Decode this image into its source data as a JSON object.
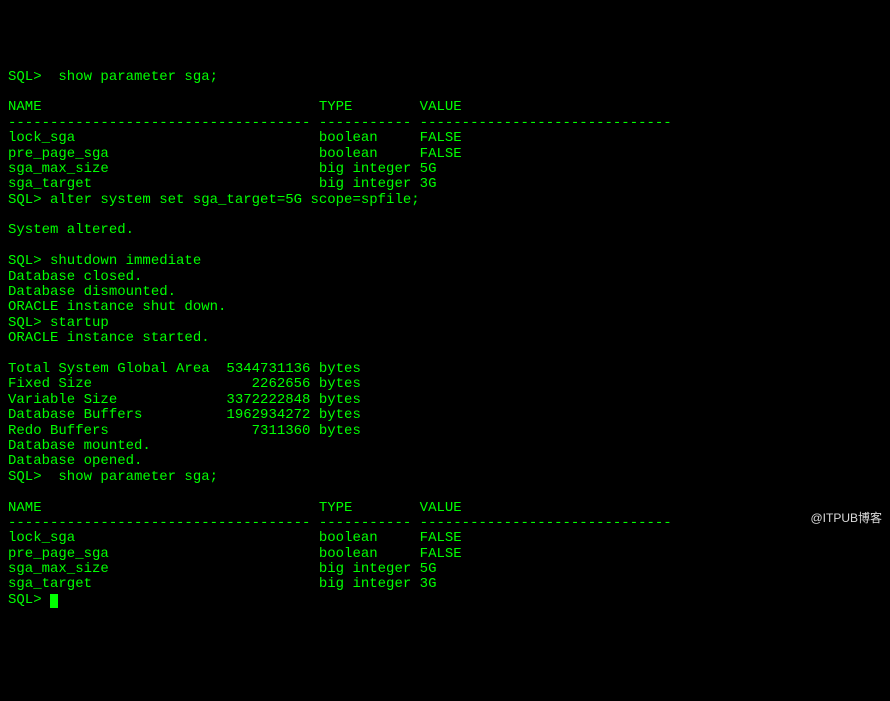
{
  "prompt": "SQL>",
  "commands": {
    "show_param": "show parameter sga;",
    "alter_system": "alter system set sga_target=5G scope=spfile;",
    "shutdown": "shutdown immediate",
    "startup": "startup"
  },
  "param_table": {
    "headers": {
      "name": "NAME",
      "type": "TYPE",
      "value": "VALUE"
    },
    "separator_name": "------------------------------------",
    "separator_type": "-----------",
    "separator_value": "------------------------------",
    "rows": [
      {
        "name": "lock_sga",
        "type": "boolean",
        "value": "FALSE"
      },
      {
        "name": "pre_page_sga",
        "type": "boolean",
        "value": "FALSE"
      },
      {
        "name": "sga_max_size",
        "type": "big integer",
        "value": "5G"
      },
      {
        "name": "sga_target",
        "type": "big integer",
        "value": "3G"
      }
    ]
  },
  "messages": {
    "system_altered": "System altered.",
    "db_closed": "Database closed.",
    "db_dismounted": "Database dismounted.",
    "instance_shut": "ORACLE instance shut down.",
    "instance_started": "ORACLE instance started.",
    "db_mounted": "Database mounted.",
    "db_opened": "Database opened."
  },
  "sga_info": {
    "total": {
      "label": "Total System Global Area",
      "value": "5344731136",
      "unit": "bytes"
    },
    "fixed": {
      "label": "Fixed Size",
      "value": "2262656",
      "unit": "bytes"
    },
    "variable": {
      "label": "Variable Size",
      "value": "3372222848",
      "unit": "bytes"
    },
    "buffers": {
      "label": "Database Buffers",
      "value": "1962934272",
      "unit": "bytes"
    },
    "redo": {
      "label": "Redo Buffers",
      "value": "7311360",
      "unit": "bytes"
    }
  },
  "watermark": "@ITPUB博客"
}
